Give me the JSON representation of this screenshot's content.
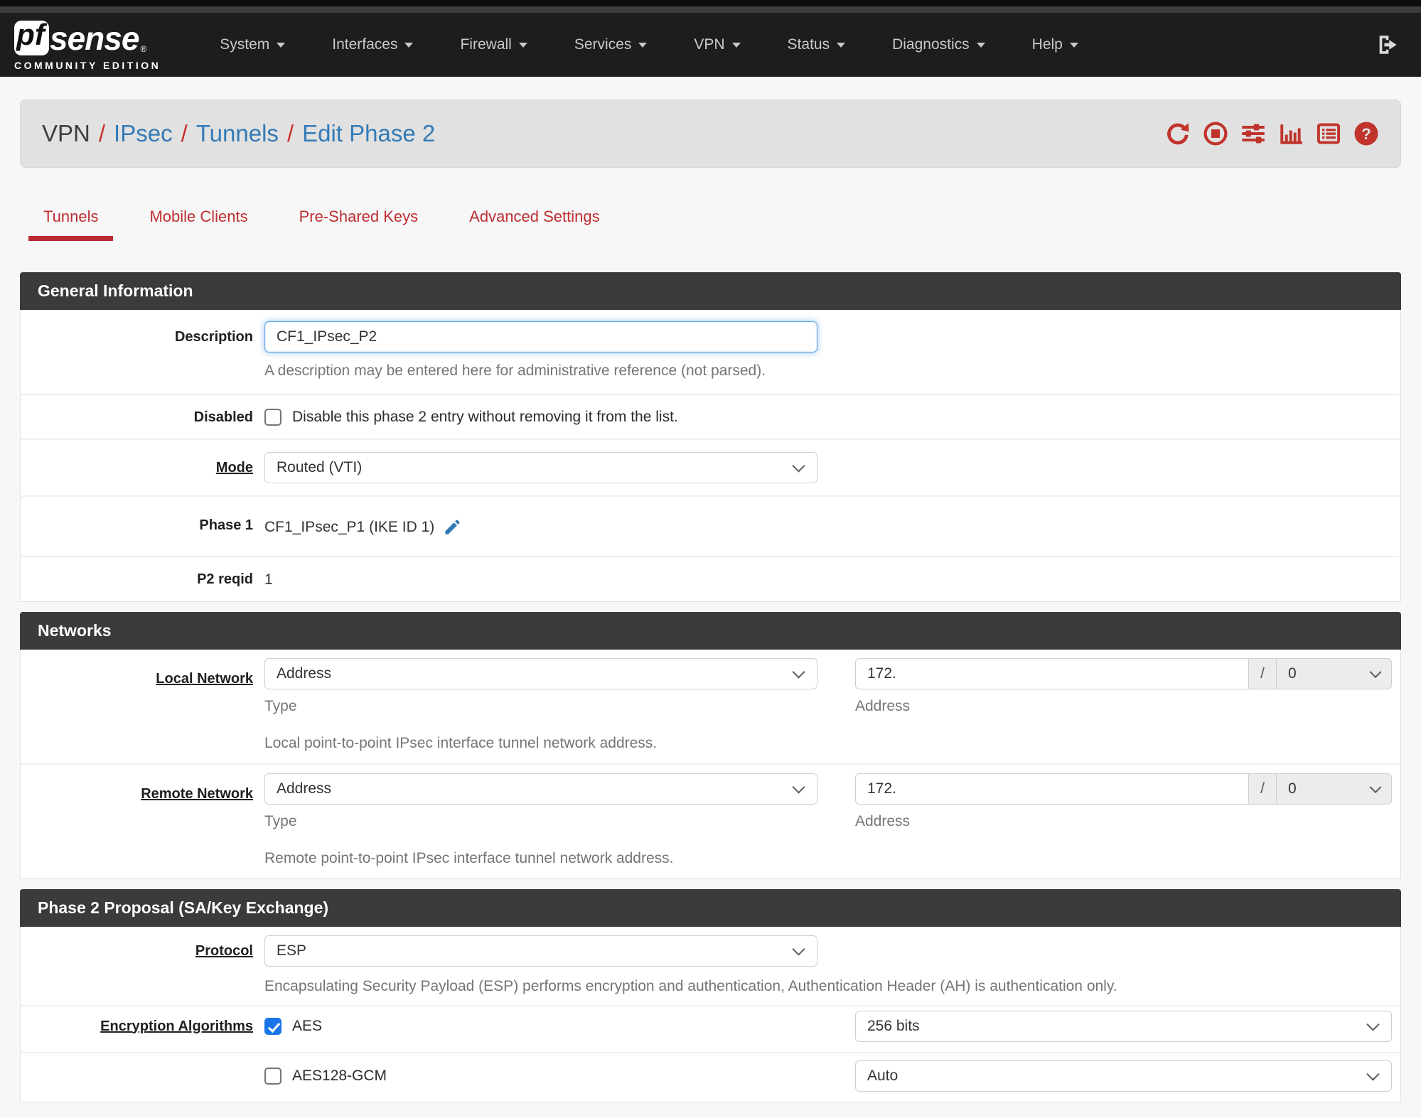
{
  "navbar": {
    "logo": {
      "pf": "pf",
      "sense": "sense",
      "registered": "®",
      "edition": "COMMUNITY EDITION"
    },
    "items": [
      {
        "label": "System"
      },
      {
        "label": "Interfaces"
      },
      {
        "label": "Firewall"
      },
      {
        "label": "Services"
      },
      {
        "label": "VPN"
      },
      {
        "label": "Status"
      },
      {
        "label": "Diagnostics"
      },
      {
        "label": "Help"
      }
    ]
  },
  "breadcrumb": {
    "current": "VPN",
    "separator": "/",
    "links": [
      "IPsec",
      "Tunnels",
      "Edit Phase 2"
    ],
    "action_icons": [
      "refresh",
      "stop-circle",
      "sliders",
      "bar-chart",
      "list-log",
      "help"
    ]
  },
  "tabs": [
    {
      "label": "Tunnels",
      "active": true
    },
    {
      "label": "Mobile Clients",
      "active": false
    },
    {
      "label": "Pre-Shared Keys",
      "active": false
    },
    {
      "label": "Advanced Settings",
      "active": false
    }
  ],
  "panels": {
    "general": {
      "title": "General Information",
      "description": {
        "label": "Description",
        "value": "CF1_IPsec_P2",
        "help": "A description may be entered here for administrative reference (not parsed)."
      },
      "disabled": {
        "label": "Disabled",
        "checkbox_label": "Disable this phase 2 entry without removing it from the list.",
        "checked": false
      },
      "mode": {
        "label": "Mode",
        "value": "Routed (VTI)"
      },
      "phase1": {
        "label": "Phase 1",
        "value": "CF1_IPsec_P1 (IKE ID 1)"
      },
      "p2reqid": {
        "label": "P2 reqid",
        "value": "1"
      }
    },
    "networks": {
      "title": "Networks",
      "local": {
        "label": "Local Network",
        "type_value": "Address",
        "type_sublabel": "Type",
        "address_value": "172.",
        "address_sublabel": "Address",
        "prefix_separator": "/",
        "prefix_value": "0",
        "help": "Local point-to-point IPsec interface tunnel network address."
      },
      "remote": {
        "label": "Remote Network",
        "type_value": "Address",
        "type_sublabel": "Type",
        "address_value": "172.",
        "address_sublabel": "Address",
        "prefix_separator": "/",
        "prefix_value": "0",
        "help": "Remote point-to-point IPsec interface tunnel network address."
      }
    },
    "proposal": {
      "title": "Phase 2 Proposal (SA/Key Exchange)",
      "protocol": {
        "label": "Protocol",
        "value": "ESP",
        "help": "Encapsulating Security Payload (ESP) performs encryption and authentication, Authentication Header (AH) is authentication only."
      },
      "encryption": {
        "label": "Encryption Algorithms",
        "rows": [
          {
            "name": "AES",
            "checked": true,
            "bits": "256 bits"
          },
          {
            "name": "AES128-GCM",
            "checked": false,
            "bits": "Auto"
          }
        ]
      }
    }
  },
  "colors": {
    "navbar_bg": "#1d1d1d",
    "panel_header_bg": "#3b3b3b",
    "accent_red": "#bf2e31",
    "icon_red": "#c0342c",
    "link_blue": "#337ab7",
    "checkbox_blue": "#1a76e8",
    "breadcrumb_bg": "#e1e1e1"
  }
}
